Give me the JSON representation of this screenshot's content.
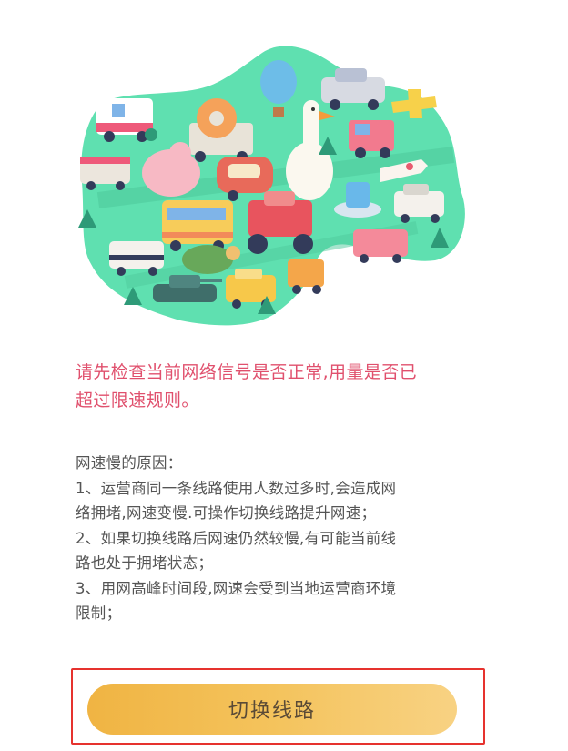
{
  "warning": {
    "line1": "请先检查当前网络信号是否正常,用量是否已",
    "line2": "超过限速规则。"
  },
  "reasons": {
    "title": "网速慢的原因：",
    "lines": [
      "1、运营商同一条线路使用人数过多时,会造成网",
      "络拥堵,网速变慢.可操作切换线路提升网速；",
      "2、如果切换线路后网速仍然较慢,有可能当前线",
      "路也处于拥堵状态；",
      "3、用网高峰时间段,网速会受到当地运营商环境",
      "限制；"
    ]
  },
  "switch_button": {
    "label": "切换线路"
  },
  "colors": {
    "warning_text": "#e0506d",
    "button_gradient_start": "#f0b443",
    "button_gradient_end": "#f8d283",
    "highlight_border": "#e6322e",
    "illustration_ground": "#5fe0b0"
  }
}
